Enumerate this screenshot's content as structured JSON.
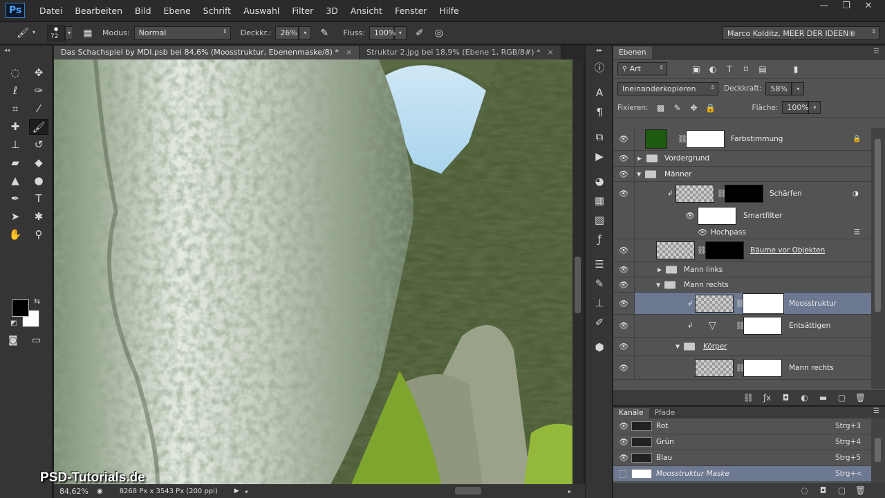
{
  "app": {
    "logo": "Ps",
    "window_controls": [
      "—",
      "❐",
      "✕"
    ]
  },
  "menu": [
    "Datei",
    "Bearbeiten",
    "Bild",
    "Ebene",
    "Schrift",
    "Auswahl",
    "Filter",
    "3D",
    "Ansicht",
    "Fenster",
    "Hilfe"
  ],
  "options": {
    "brush_size": "72",
    "modus_label": "Modus:",
    "modus_value": "Normal",
    "deckkraft_label": "Deckkr.:",
    "deckkraft_value": "26%",
    "fluss_label": "Fluss:",
    "fluss_value": "100%",
    "workspace": "Marco Kolditz, MEER DER IDEEN®"
  },
  "doc_tabs": [
    {
      "label": "Das Schachspiel by MDI.psb bei 84,6% (Moosstruktur, Ebenenmaske/8) *",
      "close": "×"
    },
    {
      "label": "Struktur 2.jpg bei 18,9% (Ebene 1, RGB/8#) *",
      "close": "×"
    }
  ],
  "status": {
    "zoom": "84,62%",
    "doc_info": "8268 Px x 3543 Px (200 ppi)"
  },
  "layers_panel": {
    "tab": "Ebenen",
    "filter_value": "Art",
    "blend_mode": "Ineinanderkopieren",
    "opacity_label": "Deckkraft:",
    "opacity_value": "58%",
    "lock_label": "Fixieren:",
    "fill_label": "Fläche:",
    "fill_value": "100%",
    "layers": [
      {
        "name": "Farbstimmung"
      },
      {
        "name": "Vordergrund"
      },
      {
        "name": "Männer"
      },
      {
        "name": "Schärfen"
      },
      {
        "name": "Smartfilter"
      },
      {
        "name": "Hochpass"
      },
      {
        "name": "Bäume vor Objekten"
      },
      {
        "name": "Mann links"
      },
      {
        "name": "Mann rechts"
      },
      {
        "name": "Moosstruktur"
      },
      {
        "name": "Entsättigen"
      },
      {
        "name": "Körper"
      },
      {
        "name": "Mann rechts"
      }
    ]
  },
  "channels_panel": {
    "tabs": [
      "Kanäle",
      "Pfade"
    ],
    "channels": [
      {
        "name": "Rot",
        "shortcut": "Strg+3"
      },
      {
        "name": "Grün",
        "shortcut": "Strg+4"
      },
      {
        "name": "Blau",
        "shortcut": "Strg+5"
      },
      {
        "name": "Moosstruktur Maske",
        "shortcut": "Strg+<"
      }
    ]
  },
  "watermark": "PSD-Tutorials.de",
  "colors": {
    "accent_selection": "#6d7891",
    "panel_bg": "#535353",
    "farbstimmung_swatch": "#1f5a12"
  }
}
